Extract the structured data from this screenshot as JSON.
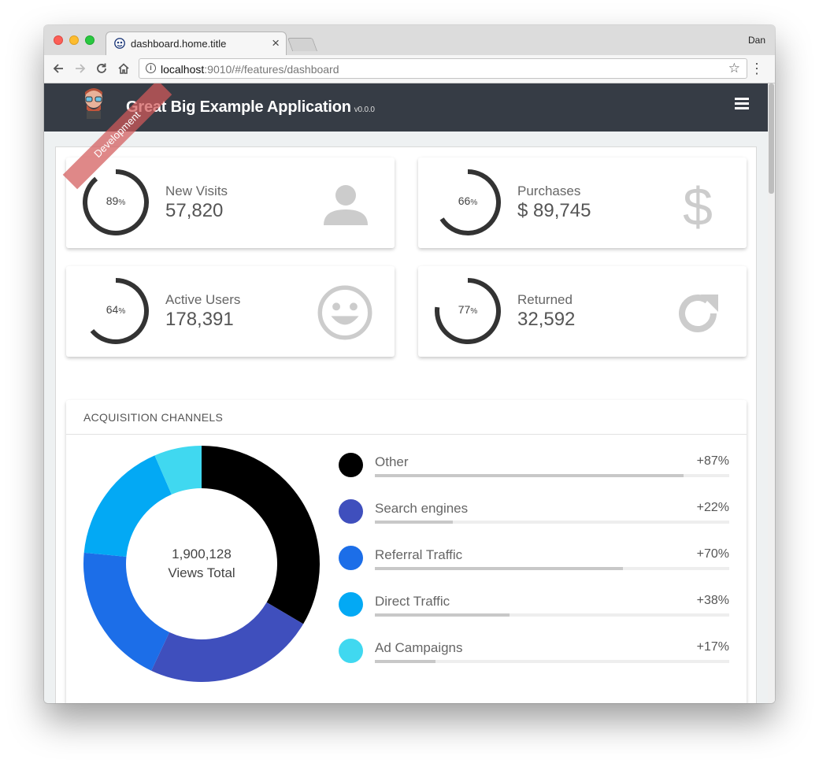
{
  "browser": {
    "tab_title": "dashboard.home.title",
    "profile_name": "Dan",
    "url_host": "localhost",
    "url_rest": ":9010/#/features/dashboard"
  },
  "app": {
    "title": "Great Big Example Application",
    "version": "v0.0.0",
    "ribbon": "Development"
  },
  "stats": [
    {
      "label": "New Visits",
      "value": "57,820",
      "percent": 89,
      "icon": "user-icon"
    },
    {
      "label": "Purchases",
      "value": "$ 89,745",
      "percent": 66,
      "icon": "dollar-icon"
    },
    {
      "label": "Active Users",
      "value": "178,391",
      "percent": 64,
      "icon": "smile-icon"
    },
    {
      "label": "Returned",
      "value": "32,592",
      "percent": 77,
      "icon": "refresh-icon"
    }
  ],
  "channels": {
    "title": "ACQUISITION CHANNELS",
    "total_value": "1,900,128",
    "total_label": "Views Total",
    "items": [
      {
        "label": "Other",
        "percent_text": "+87%",
        "percent": 87,
        "color": "#000000"
      },
      {
        "label": "Search engines",
        "percent_text": "+22%",
        "percent": 22,
        "color": "#3f4fbd"
      },
      {
        "label": "Referral Traffic",
        "percent_text": "+70%",
        "percent": 70,
        "color": "#1c6ee8"
      },
      {
        "label": "Direct Traffic",
        "percent_text": "+38%",
        "percent": 38,
        "color": "#03a9f4"
      },
      {
        "label": "Ad Campaigns",
        "percent_text": "+17%",
        "percent": 17,
        "color": "#40d8f0"
      }
    ],
    "donut_shares": [
      0.335,
      0.235,
      0.195,
      0.17,
      0.065
    ]
  },
  "colors": {
    "appbar": "#363c45",
    "gauge_stroke": "#333333",
    "icon_gray": "#cccccc"
  }
}
